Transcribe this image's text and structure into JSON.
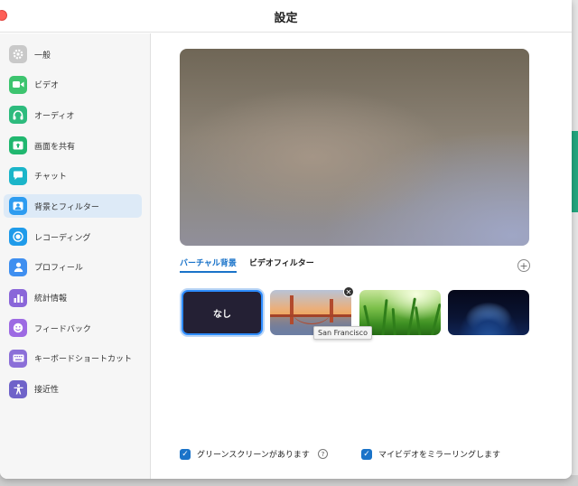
{
  "window": {
    "title": "設定"
  },
  "sidebar": {
    "items": [
      {
        "label": "一般",
        "icon": "gear-icon",
        "color": "#c9c9c9"
      },
      {
        "label": "ビデオ",
        "icon": "video-camera-icon",
        "color": "#3dc46f"
      },
      {
        "label": "オーディオ",
        "icon": "headphones-icon",
        "color": "#2dbb7d"
      },
      {
        "label": "画面を共有",
        "icon": "screen-share-icon",
        "color": "#20b76f"
      },
      {
        "label": "チャット",
        "icon": "chat-bubble-icon",
        "color": "#1bb5c9"
      },
      {
        "label": "背景とフィルター",
        "icon": "background-image-icon",
        "color": "#2d9cf0",
        "active": true
      },
      {
        "label": "レコーディング",
        "icon": "record-icon",
        "color": "#1f9bea"
      },
      {
        "label": "プロフィール",
        "icon": "person-icon",
        "color": "#3f8ff0"
      },
      {
        "label": "統計情報",
        "icon": "bar-chart-icon",
        "color": "#8a66d9"
      },
      {
        "label": "フィードバック",
        "icon": "smiley-icon",
        "color": "#9d6ae3"
      },
      {
        "label": "キーボードショートカット",
        "icon": "keyboard-icon",
        "color": "#8b6fd8"
      },
      {
        "label": "接近性",
        "icon": "accessibility-icon",
        "color": "#6f63c9"
      }
    ]
  },
  "tabs": [
    {
      "label": "バーチャル背景",
      "active": true
    },
    {
      "label": "ビデオフィルター",
      "active": false
    }
  ],
  "backgrounds": {
    "none_label": "なし",
    "hover_tooltip": "San Francisco"
  },
  "options": {
    "green_screen": {
      "label": "グリーンスクリーンがあります",
      "checked": true
    },
    "mirror_video": {
      "label": "マイビデオをミラーリングします",
      "checked": true
    }
  },
  "colors": {
    "accent": "#1a73c9",
    "selection": "#2d8cff"
  }
}
